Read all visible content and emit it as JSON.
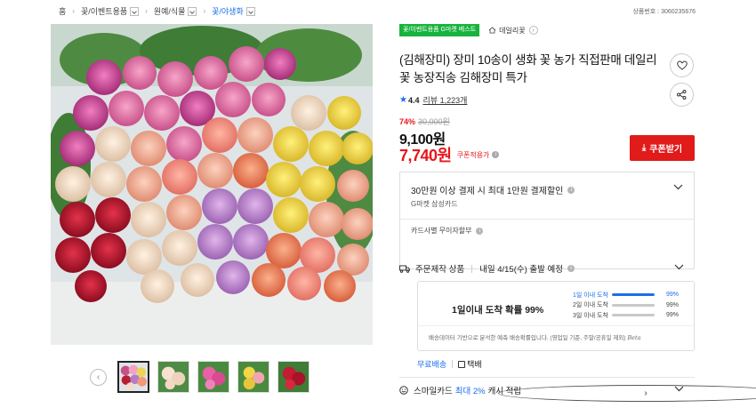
{
  "breadcrumb": [
    {
      "label": "홈",
      "dropdown": false,
      "active": false
    },
    {
      "label": "꽃/이벤트용품",
      "dropdown": true,
      "active": false
    },
    {
      "label": "원예/식물",
      "dropdown": true,
      "active": false
    },
    {
      "label": "꽃/야생화",
      "dropdown": true,
      "active": true
    }
  ],
  "product_number": "상품번호 : 3060235676",
  "badges": {
    "best": "꽃/이벤트용품 G마켓 베스트",
    "daily": "데일리꽃"
  },
  "title": "(김해장미) 장미 10송이 생화 꽃 농가 직접판매 데일리 꽃 농장직송 김해장미 특가",
  "rating": {
    "score": "4.4",
    "review_label": "리뷰",
    "review_count": "1,223개"
  },
  "price": {
    "discount_pct": "74%",
    "original": "30,000원",
    "sale": "9,100원",
    "coupon_price": "7,740원",
    "coupon_label": "쿠폰적용가"
  },
  "coupon_button": "쿠폰받기",
  "card_offer": {
    "title": "30만원 이상 결제 시 최대 1만원 결제할인",
    "card": "G마켓 삼성카드",
    "installment": "카드사별 무이자할부"
  },
  "shipping": {
    "type": "주문제작 상품",
    "departure": "내일 4/15(수) 출발 예정"
  },
  "arrival": {
    "headline": "1일이내 도착 확률 99%",
    "rows": [
      {
        "label": "1일 이내 도착",
        "value": "99%",
        "fraction": 0.99
      },
      {
        "label": "2일 이내 도착",
        "value": "99%",
        "fraction": 0.99
      },
      {
        "label": "3일 이내 도착",
        "value": "99%",
        "fraction": 0.99
      }
    ],
    "note": "배송데이터 기반으로 분석한 예측 배송확률입니다. (영업일 기준, 주말/공휴일 제외)",
    "beta": "Beta"
  },
  "delivery": {
    "fee": "무료배송",
    "method": "택배"
  },
  "smile_card": {
    "prefix": "스마일카드",
    "highlight": "최대 2%",
    "suffix": "캐시 적립"
  },
  "colors": {
    "accent_blue": "#1a6fe8",
    "price_red": "#e8161b",
    "coupon_button": "#e11a1a",
    "best_badge": "#17b33d"
  },
  "icons": [
    "chevron-down-icon",
    "heart-icon",
    "share-icon",
    "star-icon",
    "info-icon",
    "truck-icon",
    "smile-icon",
    "home-icon",
    "download-icon",
    "arrow-left-icon",
    "arrow-right-icon"
  ]
}
